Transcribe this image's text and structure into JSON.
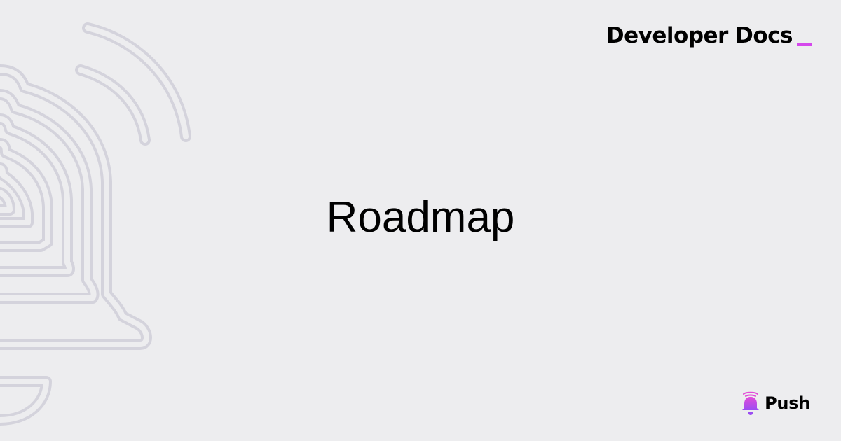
{
  "header": {
    "title": "Developer Docs"
  },
  "main": {
    "title": "Roadmap"
  },
  "brand": {
    "name": "Push",
    "icon": "bell-icon",
    "accent_color": "#D548EC"
  },
  "background": {
    "color": "#EDEDEF",
    "decoration_icon": "bell-outline-icon",
    "decoration_color": "#D4D3DC"
  }
}
